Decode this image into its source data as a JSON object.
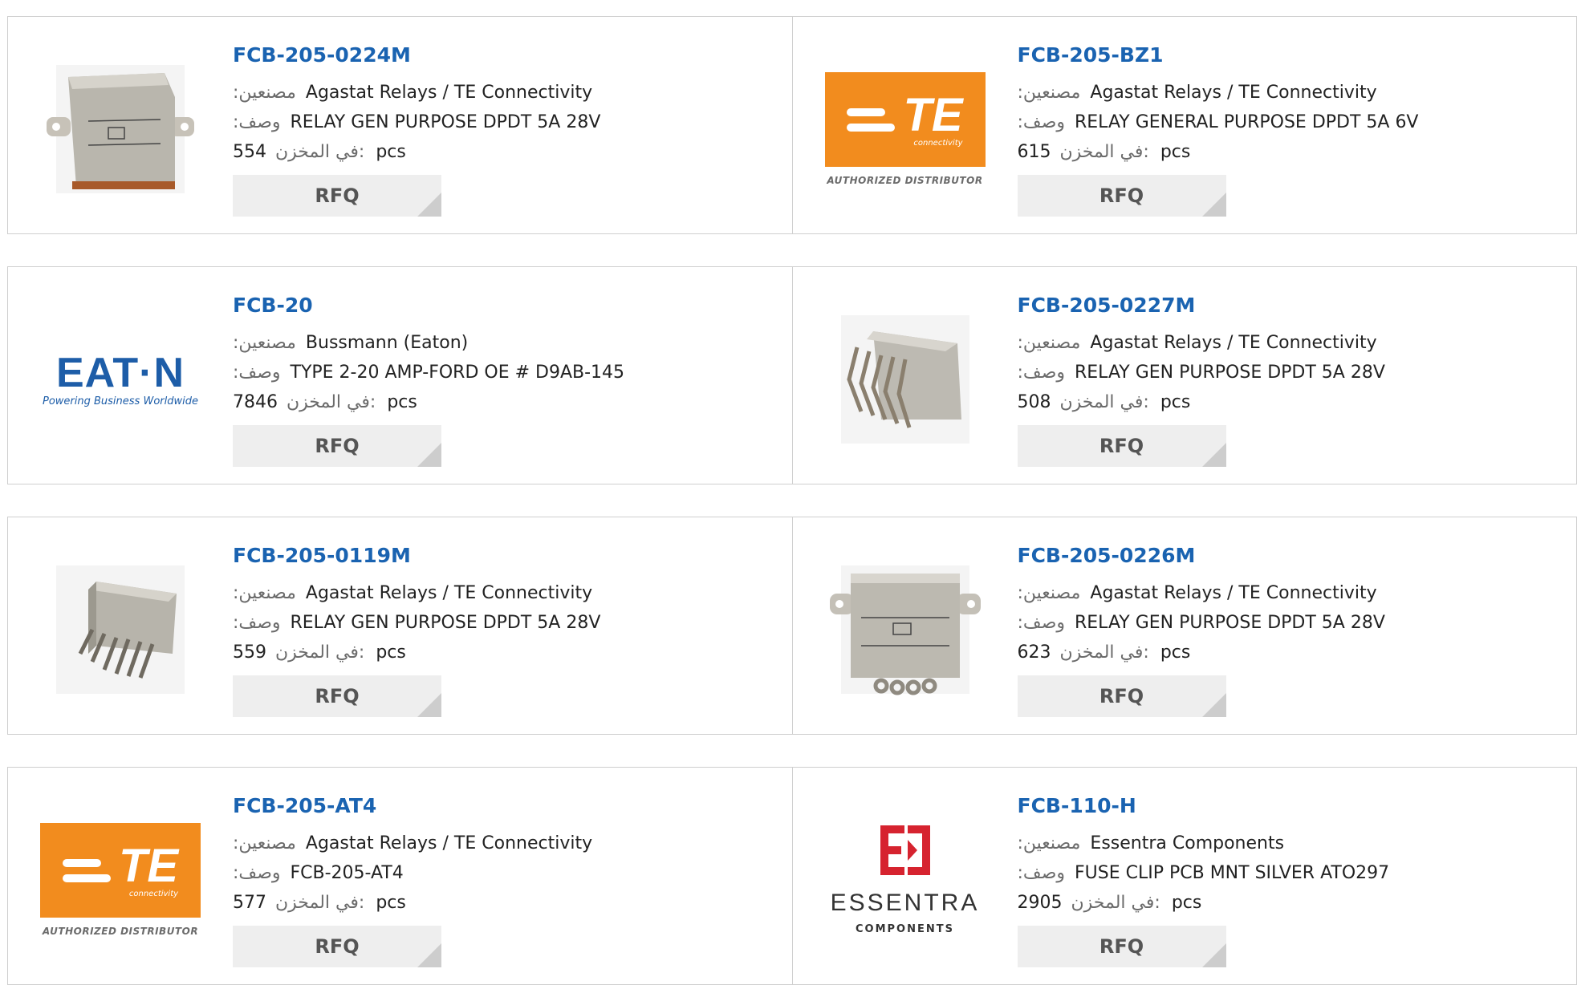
{
  "labels": {
    "manufacturer": ":مصنعين",
    "description": ":وصف",
    "in_stock": "في المخزن:",
    "unit": "pcs",
    "rfq": "RFQ"
  },
  "products": [
    {
      "part": "FCB-205-0224M",
      "manufacturer": "Agastat Relays / TE Connectivity",
      "description": "RELAY GEN PURPOSE DPDT 5A 28V",
      "stock": "554",
      "image": "relay-product-image"
    },
    {
      "part": "FCB-205-BZ1",
      "manufacturer": "Agastat Relays / TE Connectivity",
      "description": "RELAY GENERAL PURPOSE DPDT 5A 6V",
      "stock": "615",
      "image": "te-connectivity-logo"
    },
    {
      "part": "FCB-20",
      "manufacturer": "Bussmann (Eaton)",
      "description": "TYPE 2-20 AMP-FORD OE # D9AB-145",
      "stock": "7846",
      "image": "eaton-logo"
    },
    {
      "part": "FCB-205-0227M",
      "manufacturer": "Agastat Relays / TE Connectivity",
      "description": "RELAY GEN PURPOSE DPDT 5A 28V",
      "stock": "508",
      "image": "relay-product-image"
    },
    {
      "part": "FCB-205-0119M",
      "manufacturer": "Agastat Relays / TE Connectivity",
      "description": "RELAY GEN PURPOSE DPDT 5A 28V",
      "stock": "559",
      "image": "relay-product-image"
    },
    {
      "part": "FCB-205-0226M",
      "manufacturer": "Agastat Relays / TE Connectivity",
      "description": "RELAY GEN PURPOSE DPDT 5A 28V",
      "stock": "623",
      "image": "relay-product-image"
    },
    {
      "part": "FCB-205-AT4",
      "manufacturer": "Agastat Relays / TE Connectivity",
      "description": "FCB-205-AT4",
      "stock": "577",
      "image": "te-connectivity-logo"
    },
    {
      "part": "FCB-110-H",
      "manufacturer": "Essentra Components",
      "description": "FUSE CLIP PCB MNT SILVER ATO297",
      "stock": "2905",
      "image": "essentra-logo"
    }
  ],
  "logos": {
    "te": {
      "word": "TE",
      "sub": "connectivity",
      "tagline": "AUTHORIZED DISTRIBUTOR"
    },
    "eaton": {
      "word": "EAT·N",
      "tagline": "Powering Business Worldwide"
    },
    "essentra": {
      "word": "ESSENTRA",
      "tagline": "COMPONENTS"
    }
  },
  "colors": {
    "link": "#1a63b1",
    "te_orange": "#f28c1e",
    "eaton_blue": "#1d5da8",
    "essentra_red": "#d6232f",
    "rfq_bg": "#eeeeee"
  }
}
